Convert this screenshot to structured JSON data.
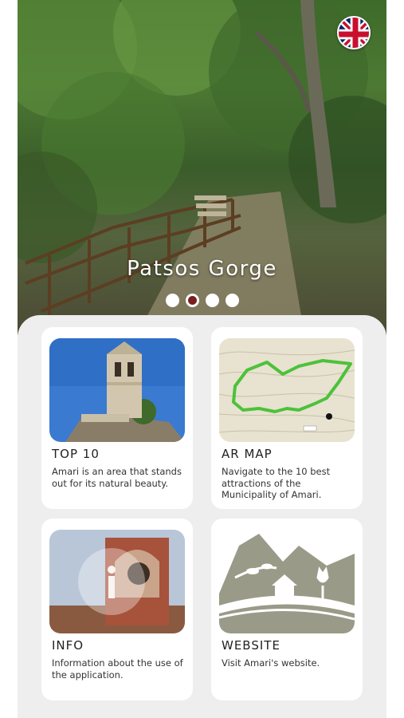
{
  "hero": {
    "title": "Patsos Gorge",
    "slides": 4,
    "active_slide": 2
  },
  "language": {
    "icon": "uk-flag-icon"
  },
  "cards": [
    {
      "title": "TOP 10",
      "description": "Amari is an area that stands out for its natural beauty.",
      "icon": "bell-tower-photo"
    },
    {
      "title": "AR MAP",
      "description": "Navigate to the 10 best attractions of the Municipality of Amari.",
      "icon": "trail-map-image"
    },
    {
      "title": "INFO",
      "description": "Information about the use of the application.",
      "icon": "info-icon"
    },
    {
      "title": "WEBSITE",
      "description": "Visit Amari's website.",
      "icon": "landscape-logo-icon"
    }
  ],
  "colors": {
    "active_dot": "#7a1f1f",
    "trail": "#4cc23a",
    "logo_gray": "#9a9a88"
  }
}
